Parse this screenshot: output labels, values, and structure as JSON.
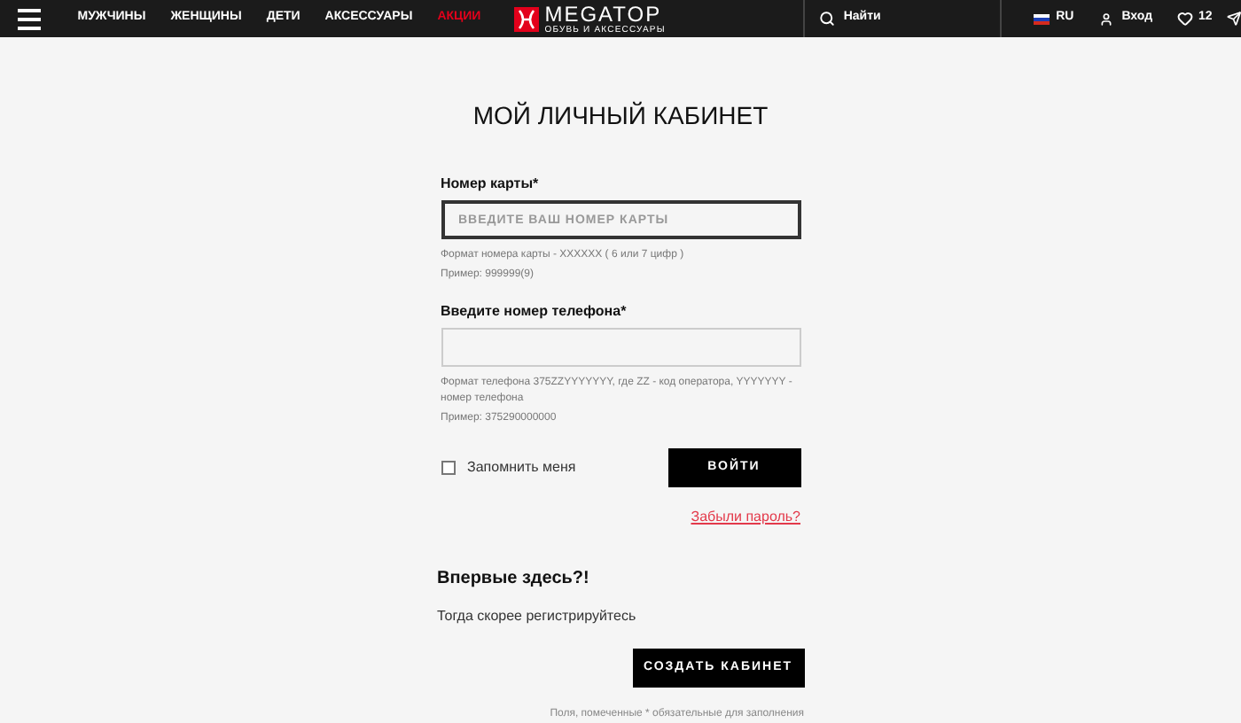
{
  "header": {
    "nav": [
      {
        "label": "МУЖЧИНЫ",
        "highlighted": false
      },
      {
        "label": "ЖЕНЩИНЫ",
        "highlighted": false
      },
      {
        "label": "ДЕТИ",
        "highlighted": false
      },
      {
        "label": "АКСЕССУАРЫ",
        "highlighted": false
      },
      {
        "label": "АКЦИИ",
        "highlighted": true
      }
    ],
    "logo": {
      "name": "MEGATOP",
      "tagline": "ОБУВЬ И АКСЕССУАРЫ"
    },
    "search": "Найти",
    "language": "RU",
    "login": "Вход",
    "favorites_count": "12"
  },
  "title": "МОЙ ЛИЧНЫЙ КАБИНЕТ",
  "card_field": {
    "label": "Номер карты",
    "required_mark": "*",
    "placeholder": "ВВЕДИТЕ ВАШ НОМЕР КАРТЫ",
    "hints": [
      "Формат номера карты - XXXXXX ( 6 или 7 цифр )",
      "Пример: 999999(9)"
    ]
  },
  "phone_field": {
    "label": "Введите номер телефона",
    "required_mark": "*",
    "hints": [
      "Формат телефона 375ZZYYYYYYY, где ZZ - код оператора, YYYYYYY - номер телефона",
      "Пример: 375290000000"
    ]
  },
  "remember_me": {
    "label": "Запомнить меня",
    "checked": false
  },
  "login_button": "ВОЙТИ",
  "forgot_link": "Забыли пароль?",
  "register": {
    "heading": "Впервые здесь?!",
    "text": "Тогда скорее регистрируйтесь",
    "button": "СОЗДАТЬ КАБИНЕТ"
  },
  "footnote": "Поля, помеченные * обязательные для заполнения"
}
